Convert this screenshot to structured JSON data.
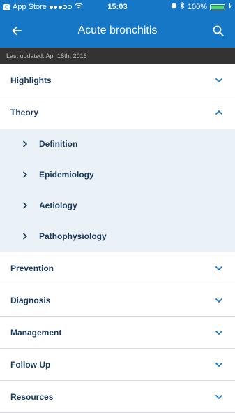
{
  "status_bar": {
    "carrier": "App Store",
    "time": "15:03",
    "battery_percent": "100%",
    "battery_level": 1.0
  },
  "nav": {
    "title": "Acute bronchitis"
  },
  "updated": "Last updated: Apr 18th, 2016",
  "sections": [
    {
      "label": "Highlights",
      "expanded": false
    },
    {
      "label": "Theory",
      "expanded": true,
      "items": [
        "Definition",
        "Epidemiology",
        "Aetiology",
        "Pathophysiology"
      ]
    },
    {
      "label": "Prevention",
      "expanded": false
    },
    {
      "label": "Diagnosis",
      "expanded": false
    },
    {
      "label": "Management",
      "expanded": false
    },
    {
      "label": "Follow Up",
      "expanded": false
    },
    {
      "label": "Resources",
      "expanded": false
    }
  ],
  "colors": {
    "header_blue": "#1677c6",
    "updated_bar": "#333333",
    "section_text": "#1a3a5c",
    "chevron": "#1677c6",
    "expanded_bg": "#eaf2f8"
  }
}
